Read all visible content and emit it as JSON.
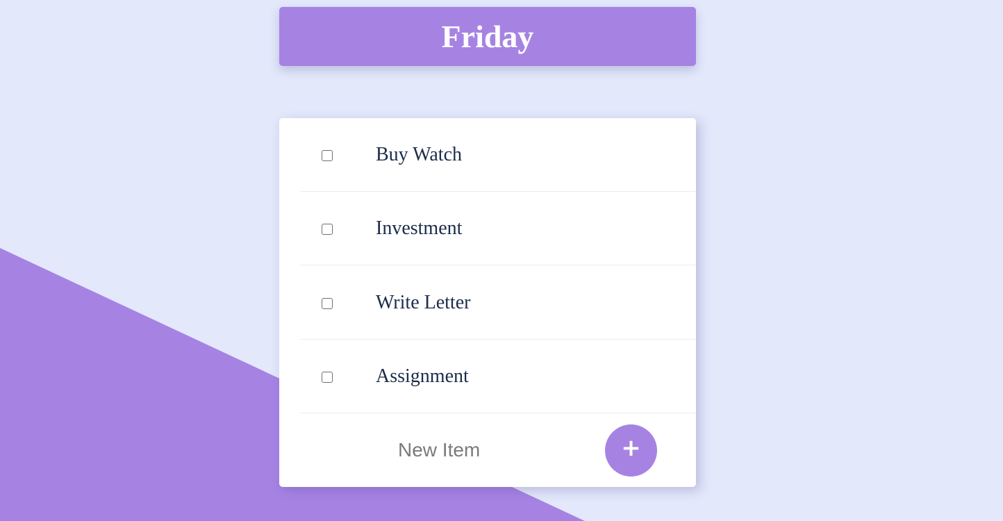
{
  "header": {
    "title": "Friday"
  },
  "todo": {
    "items": [
      {
        "label": "Buy Watch",
        "checked": false
      },
      {
        "label": "Investment",
        "checked": false
      },
      {
        "label": "Write Letter",
        "checked": false
      },
      {
        "label": "Assignment",
        "checked": false
      }
    ],
    "new_item": {
      "placeholder": "New Item",
      "value": "",
      "add_button_icon": "plus-icon",
      "add_button_symbol": "+"
    }
  },
  "colors": {
    "background": "#e3e8fb",
    "accent": "#a683e3",
    "card": "#ffffff",
    "item_text": "#1b2c4a"
  }
}
